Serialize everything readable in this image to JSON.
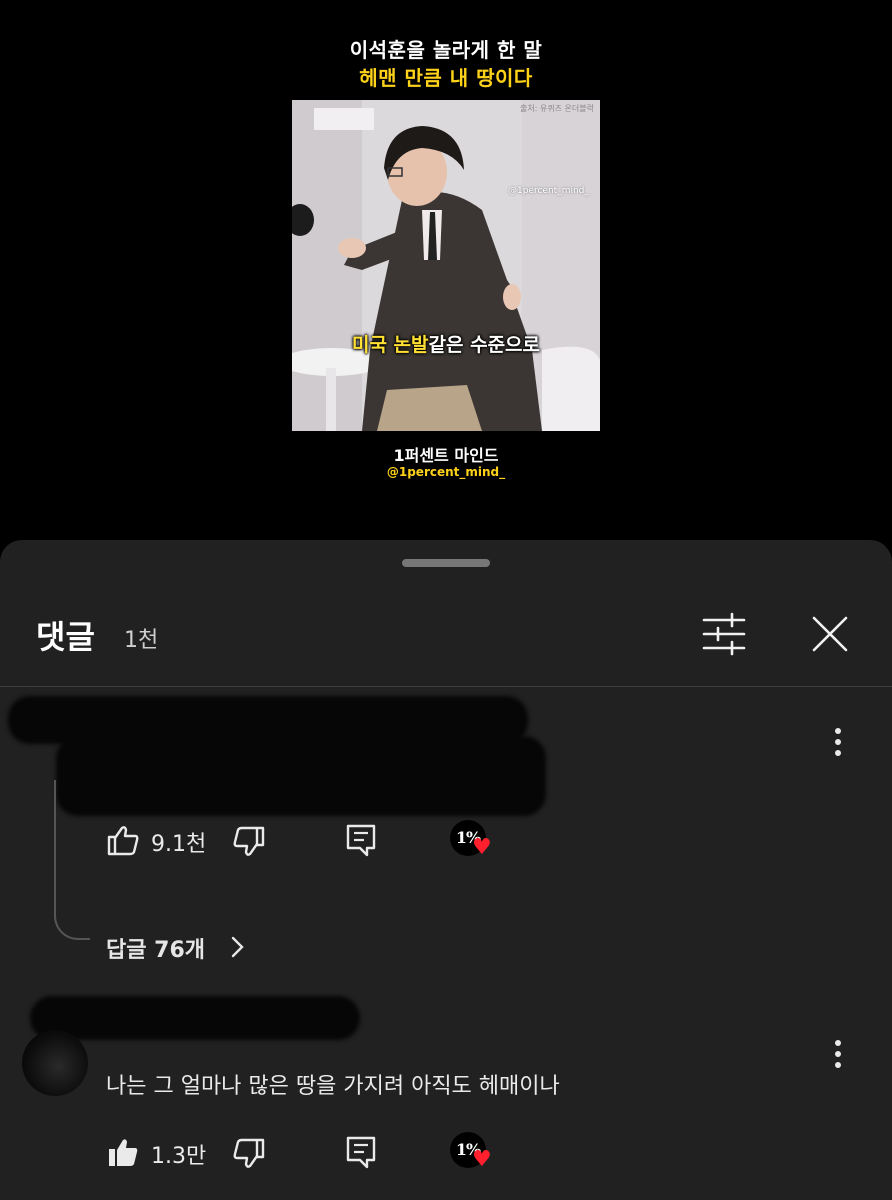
{
  "video": {
    "overlay_title_line1": "이석훈을 놀라게 한 말",
    "overlay_title_line2": "헤맨 만큼 내 땅이다",
    "frame_watermark_top": "출처: 유퀴즈 온더블럭",
    "frame_watermark_handle": "@1percent_mind_",
    "subtitle_highlight": "미국 논발",
    "subtitle_rest": "같은 수준으로",
    "channel_name": "1퍼센트 마인드",
    "channel_handle": "@1percent_mind_"
  },
  "comments_panel": {
    "title": "댓글",
    "count": "1천",
    "sort_icon": "sliders-icon",
    "close_icon": "close-x-icon",
    "comments": [
      {
        "text": "",
        "likes": "9.1천",
        "replies_label": "답글 76개",
        "creator_heart_badge": "1%",
        "liked": false
      },
      {
        "text": "나는 그 얼마나 많은 땅을 가지려 아직도 헤매이나",
        "likes": "1.3만",
        "creator_heart_badge": "1%",
        "liked": true
      }
    ]
  },
  "colors": {
    "panel_bg": "#212121",
    "highlight_yellow": "#ffd21a",
    "heart_red": "#ff1f2d"
  }
}
